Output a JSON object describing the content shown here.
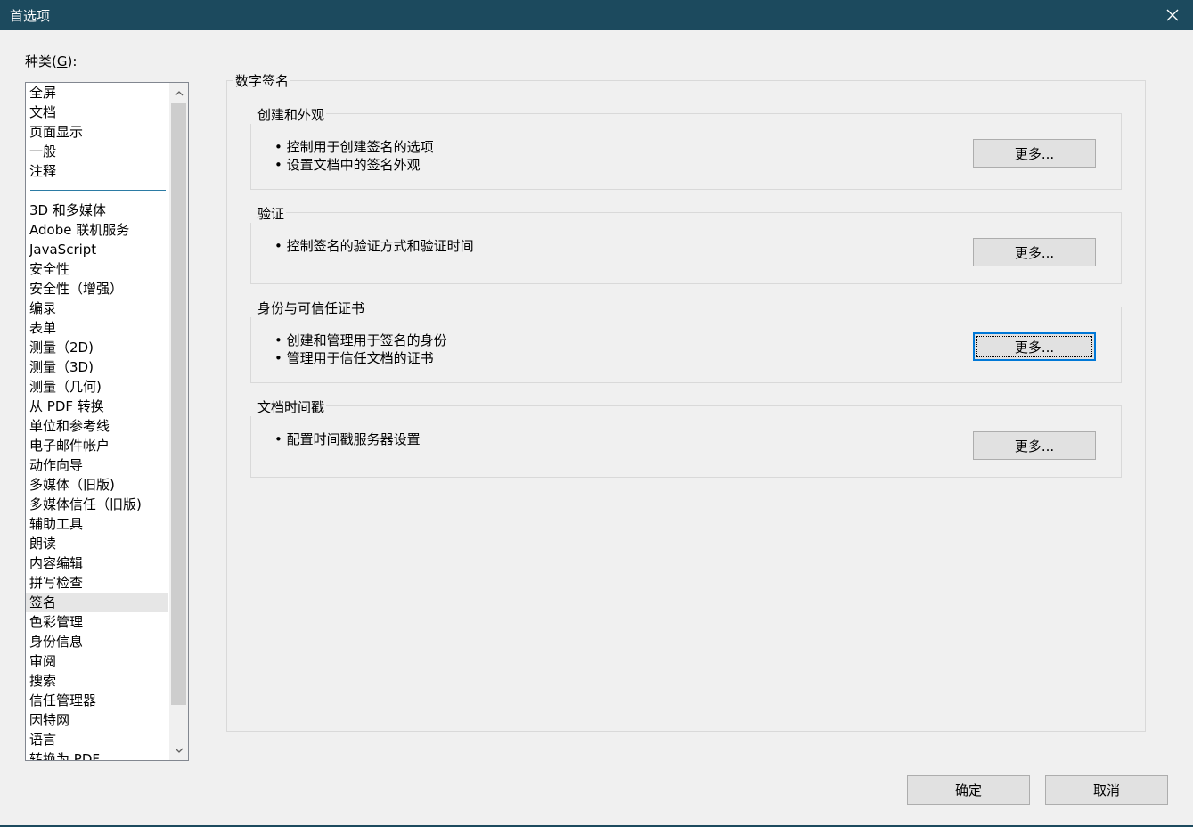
{
  "window": {
    "title": "首选项"
  },
  "category": {
    "label_prefix": "种类(",
    "label_key": "G",
    "label_suffix": "):"
  },
  "list": {
    "items_top": [
      "全屏",
      "文档",
      "页面显示",
      "一般",
      "注释"
    ],
    "items_bottom": [
      "3D 和多媒体",
      "Adobe 联机服务",
      "JavaScript",
      "安全性",
      "安全性（增强）",
      "编录",
      "表单",
      "测量（2D)",
      "测量（3D)",
      "测量（几何)",
      "从 PDF 转换",
      "单位和参考线",
      "电子邮件帐户",
      "动作向导",
      "多媒体（旧版)",
      "多媒体信任（旧版)",
      "辅助工具",
      "朗读",
      "内容编辑",
      "拼写检查",
      "签名",
      "色彩管理",
      "身份信息",
      "审阅",
      "搜索",
      "信任管理器",
      "因特网",
      "语言",
      "转换为 PDF"
    ],
    "selected": "签名"
  },
  "main": {
    "section_title": "数字签名",
    "groups": [
      {
        "title": "创建和外观",
        "bullets": [
          "控制用于创建签名的选项",
          "设置文档中的签名外观"
        ],
        "button": "更多..."
      },
      {
        "title": "验证",
        "bullets": [
          "控制签名的验证方式和验证时间"
        ],
        "button": "更多..."
      },
      {
        "title": "身份与可信任证书",
        "bullets": [
          "创建和管理用于签名的身份",
          "管理用于信任文档的证书"
        ],
        "button": "更多..."
      },
      {
        "title": "文档时间戳",
        "bullets": [
          "配置时间戳服务器设置"
        ],
        "button": "更多..."
      }
    ]
  },
  "footer": {
    "ok": "确定",
    "cancel": "取消"
  },
  "colors": {
    "titlebar": "#1c4a5e",
    "focus": "#0078d7",
    "separator": "#2b7ba4"
  }
}
